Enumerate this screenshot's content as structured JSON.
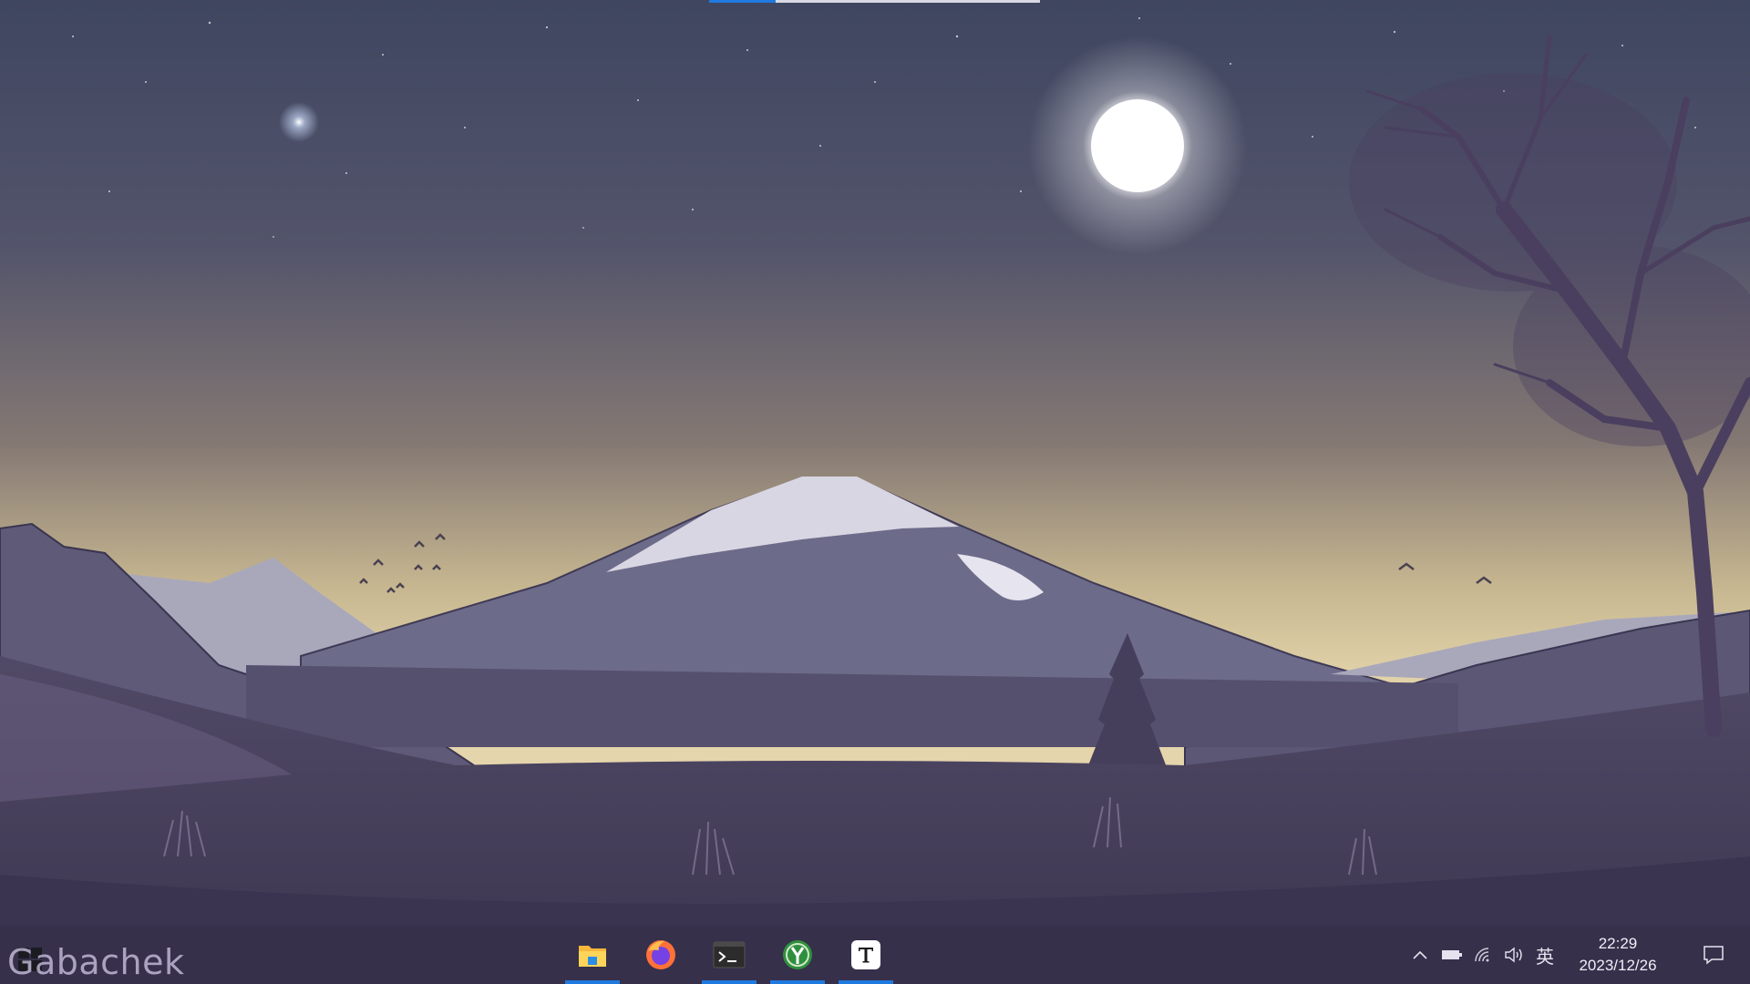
{
  "desktop": {
    "watermark_text": "Gabachek",
    "top_indicator_progress": 0.2
  },
  "taskbar": {
    "start_icon": "windows-logo-icon",
    "apps": [
      {
        "name": "File Explorer",
        "icon": "folder-icon",
        "active": true
      },
      {
        "name": "Firefox",
        "icon": "firefox-icon",
        "active": false
      },
      {
        "name": "Terminal",
        "icon": "terminal-icon",
        "active": true
      },
      {
        "name": "App",
        "icon": "green-y-app-icon",
        "active": true
      },
      {
        "name": "Typora",
        "icon": "text-t-icon",
        "active": true
      }
    ],
    "tray": {
      "ime_label": "英",
      "time": "22:29",
      "date": "2023/12/26",
      "icons": [
        "chevron-up-icon",
        "battery-icon",
        "wifi-icon",
        "volume-icon",
        "notification-icon"
      ]
    }
  },
  "colors": {
    "accent": "#1f7ae0",
    "sky_top": "#3f4660",
    "horizon": "#e5d5ac",
    "mountain": "#6d6b8a"
  }
}
